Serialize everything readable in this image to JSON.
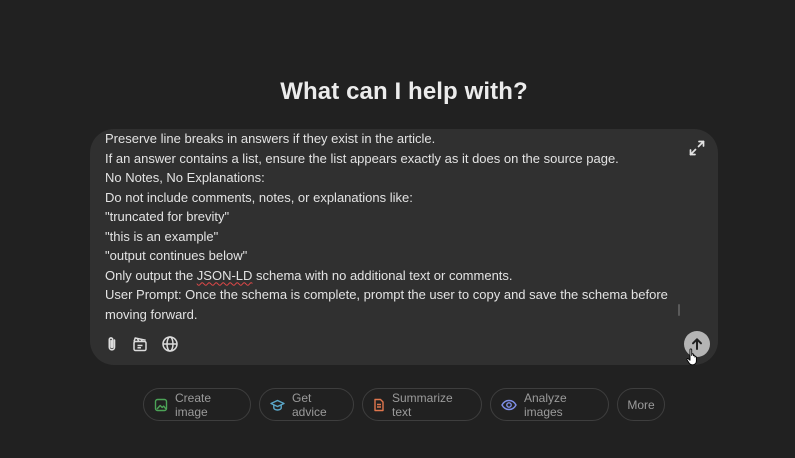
{
  "heading": "What can I help with?",
  "composer": {
    "lines": [
      "Preserve line breaks in answers if they exist in the article.",
      "If an answer contains a list, ensure the list appears exactly as it does on the source page.",
      "No Notes, No Explanations:",
      "Do not include comments, notes, or explanations like:",
      "\"truncated for brevity\"",
      "\"this is an example\"",
      "\"output continues below\"",
      "Only output the ",
      "JSON-LD",
      " schema with no additional text or comments.",
      "User Prompt: Once the schema is complete, prompt the user to copy and save the schema before",
      "moving forward."
    ],
    "expand_icon": "expand-icon",
    "tools": [
      "paperclip-icon",
      "clapperboard-icon",
      "globe-icon"
    ],
    "send_icon": "arrow-up-icon"
  },
  "chips": [
    {
      "label": "Create image",
      "icon": "image-icon",
      "color": "#4ca357"
    },
    {
      "label": "Get advice",
      "icon": "graduation-cap-icon",
      "color": "#5aa7c9"
    },
    {
      "label": "Summarize text",
      "icon": "document-icon",
      "color": "#e0764d"
    },
    {
      "label": "Analyze images",
      "icon": "eye-icon",
      "color": "#7f8fe8"
    },
    {
      "label": "More",
      "icon": "",
      "color": "#9b9b9b"
    }
  ]
}
